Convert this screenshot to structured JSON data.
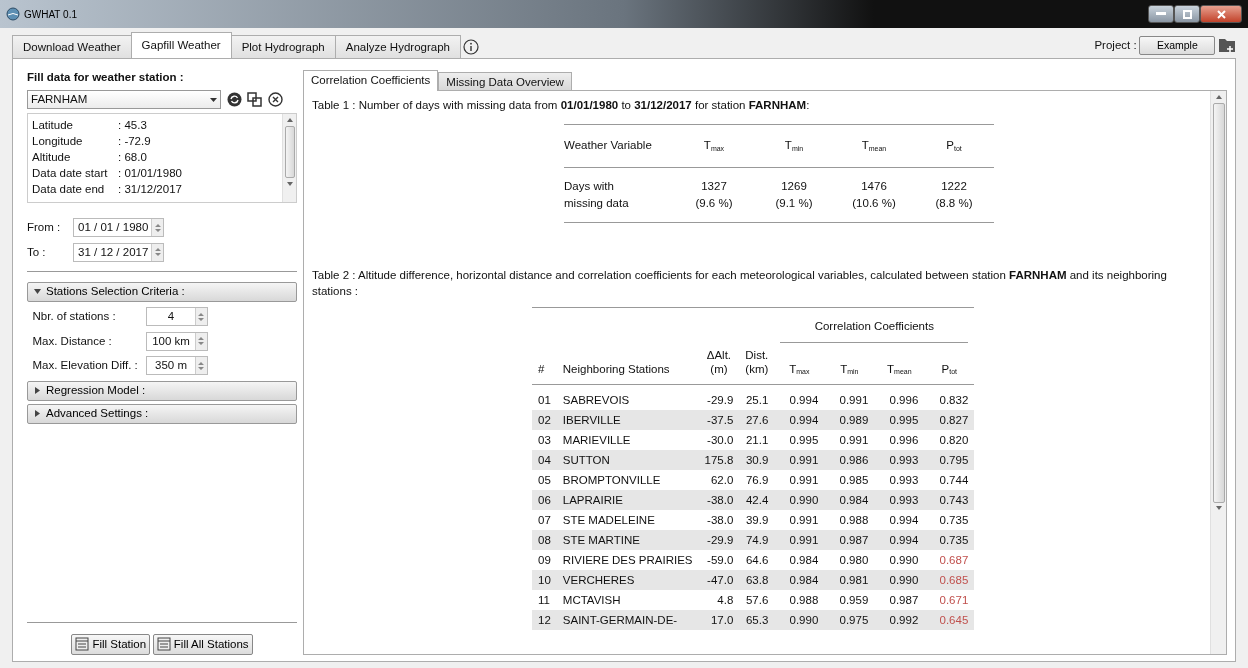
{
  "window": {
    "title": "GWHAT 0.1"
  },
  "tabs": [
    {
      "label": "Download Weather",
      "selected": false
    },
    {
      "label": "Gapfill Weather",
      "selected": true
    },
    {
      "label": "Plot Hydrograph",
      "selected": false
    },
    {
      "label": "Analyze Hydrograph",
      "selected": false
    }
  ],
  "project": {
    "label": "Project :",
    "name": "Example"
  },
  "left_panel": {
    "heading": "Fill data for weather station :",
    "station": "FARNHAM",
    "info": [
      {
        "key": "Latitude",
        "value": ": 45.3"
      },
      {
        "key": "Longitude",
        "value": ": -72.9"
      },
      {
        "key": "Altitude",
        "value": ": 68.0"
      },
      {
        "key": "Data date start",
        "value": ": 01/01/1980"
      },
      {
        "key": "Data date end",
        "value": ": 31/12/2017"
      }
    ],
    "from": {
      "label": "From :",
      "value": "01 / 01 / 1980"
    },
    "to": {
      "label": "To :",
      "value": "31 / 12 / 2017"
    },
    "sections": [
      {
        "title": "Stations Selection Criteria :",
        "expanded": true,
        "fields": [
          {
            "label": "Nbr. of stations :",
            "value": "4"
          },
          {
            "label": "Max. Distance :",
            "value": "100 km"
          },
          {
            "label": "Max. Elevation Diff. :",
            "value": "350 m"
          }
        ]
      },
      {
        "title": "Regression Model :",
        "expanded": false
      },
      {
        "title": "Advanced Settings :",
        "expanded": false
      }
    ],
    "buttons": [
      "Fill Station",
      "Fill All Stations"
    ]
  },
  "subtabs": [
    {
      "label": "Correlation Coefficients",
      "selected": true
    },
    {
      "label": "Missing Data Overview",
      "selected": false
    }
  ],
  "table1": {
    "caption": "Table 1 : Number of days with missing data from **01/01/1980** to **31/12/2017** for station **FARNHAM**:",
    "columns": [
      "Weather Variable",
      "T$_{max}$",
      "T$_{min}$",
      "T$_{mean}$",
      "P$_{tot}$"
    ],
    "row": [
      "Days with\nmissing data",
      "1327\n(9.6 %)",
      "1269\n(9.1 %)",
      "1476\n(10.6 %)",
      "1222\n(8.8 %)"
    ]
  },
  "table2": {
    "caption": "Table 2 : Altitude difference, horizontal distance and correlation coefficients for each meteorological variables, calculated between station **FARNHAM** and its neighboring stations :",
    "group_header": "Correlation Coefficients",
    "columns": [
      "#",
      "Neighboring Stations",
      "ΔAlt.\n(m)",
      "Dist.\n(km)",
      "T$_{max}$",
      "T$_{min}$",
      "T$_{mean}$",
      "P$_{tot}$"
    ],
    "rows": [
      {
        "cells": [
          "01",
          "SABREVOIS",
          "-29.9",
          "25.1",
          "0.994",
          "0.991",
          "0.996",
          "0.832"
        ],
        "low_ptot": false
      },
      {
        "cells": [
          "02",
          "IBERVILLE",
          "-37.5",
          "27.6",
          "0.994",
          "0.989",
          "0.995",
          "0.827"
        ],
        "low_ptot": false
      },
      {
        "cells": [
          "03",
          "MARIEVILLE",
          "-30.0",
          "21.1",
          "0.995",
          "0.991",
          "0.996",
          "0.820"
        ],
        "low_ptot": false
      },
      {
        "cells": [
          "04",
          "SUTTON",
          "175.8",
          "30.9",
          "0.991",
          "0.986",
          "0.993",
          "0.795"
        ],
        "low_ptot": false
      },
      {
        "cells": [
          "05",
          "BROMPTONVILLE",
          "62.0",
          "76.9",
          "0.991",
          "0.985",
          "0.993",
          "0.744"
        ],
        "low_ptot": false
      },
      {
        "cells": [
          "06",
          "LAPRAIRIE",
          "-38.0",
          "42.4",
          "0.990",
          "0.984",
          "0.993",
          "0.743"
        ],
        "low_ptot": false
      },
      {
        "cells": [
          "07",
          "STE MADELEINE",
          "-38.0",
          "39.9",
          "0.991",
          "0.988",
          "0.994",
          "0.735"
        ],
        "low_ptot": false
      },
      {
        "cells": [
          "08",
          "STE MARTINE",
          "-29.9",
          "74.9",
          "0.991",
          "0.987",
          "0.994",
          "0.735"
        ],
        "low_ptot": false
      },
      {
        "cells": [
          "09",
          "RIVIERE DES PRAIRIES",
          "-59.0",
          "64.6",
          "0.984",
          "0.980",
          "0.990",
          "0.687"
        ],
        "low_ptot": true
      },
      {
        "cells": [
          "10",
          "VERCHERES",
          "-47.0",
          "63.8",
          "0.984",
          "0.981",
          "0.990",
          "0.685"
        ],
        "low_ptot": true
      },
      {
        "cells": [
          "11",
          "MCTAVISH",
          "4.8",
          "57.6",
          "0.988",
          "0.959",
          "0.987",
          "0.671"
        ],
        "low_ptot": true
      },
      {
        "cells": [
          "12",
          "SAINT-GERMAIN-DE-",
          "17.0",
          "65.3",
          "0.990",
          "0.975",
          "0.992",
          "0.645"
        ],
        "low_ptot": true
      }
    ]
  }
}
